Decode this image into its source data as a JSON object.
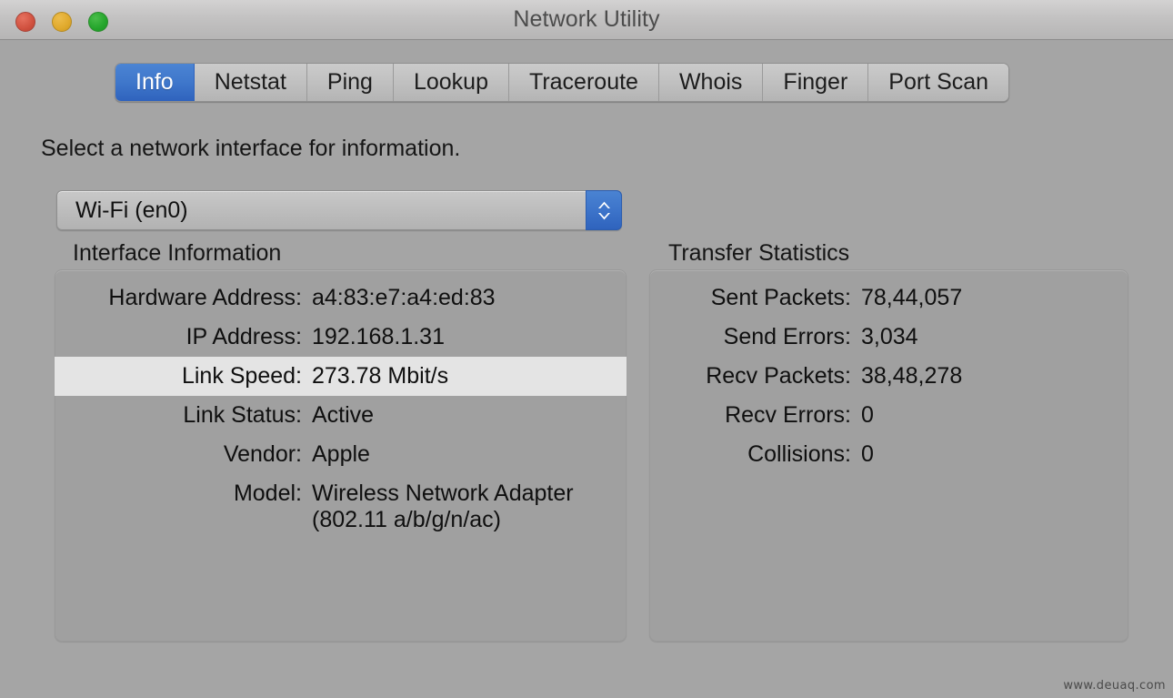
{
  "window": {
    "title": "Network Utility",
    "traffic_lights": [
      {
        "name": "close",
        "color": "#d0513f"
      },
      {
        "name": "minimize",
        "color": "#e0a92c"
      },
      {
        "name": "zoom",
        "color": "#24a52b"
      }
    ]
  },
  "tabs": [
    {
      "label": "Info",
      "selected": true
    },
    {
      "label": "Netstat",
      "selected": false
    },
    {
      "label": "Ping",
      "selected": false
    },
    {
      "label": "Lookup",
      "selected": false
    },
    {
      "label": "Traceroute",
      "selected": false
    },
    {
      "label": "Whois",
      "selected": false
    },
    {
      "label": "Finger",
      "selected": false
    },
    {
      "label": "Port Scan",
      "selected": false
    }
  ],
  "main": {
    "instruction": "Select a network interface for information.",
    "interface_select": {
      "value": "Wi-Fi (en0)",
      "stepper_icon": "chevron-up-down-icon",
      "accent": "#3d74ca"
    },
    "interface_information": {
      "title": "Interface Information",
      "rows": [
        {
          "label": "Hardware Address:",
          "value": "a4:83:e7:a4:ed:83",
          "highlighted": false
        },
        {
          "label": "IP Address:",
          "value": "192.168.1.31",
          "highlighted": false
        },
        {
          "label": "Link Speed:",
          "value": "273.78 Mbit/s",
          "highlighted": true
        },
        {
          "label": "Link Status:",
          "value": "Active",
          "highlighted": false
        },
        {
          "label": "Vendor:",
          "value": "Apple",
          "highlighted": false
        },
        {
          "label": "Model:",
          "value": "Wireless Network Adapter\n(802.11 a/b/g/n/ac)",
          "highlighted": false
        }
      ]
    },
    "transfer_statistics": {
      "title": "Transfer Statistics",
      "rows": [
        {
          "label": "Sent Packets:",
          "value": "78,44,057",
          "highlighted": false
        },
        {
          "label": "Send Errors:",
          "value": "3,034",
          "highlighted": false
        },
        {
          "label": "Recv Packets:",
          "value": "38,48,278",
          "highlighted": false
        },
        {
          "label": "Recv Errors:",
          "value": "0",
          "highlighted": false
        },
        {
          "label": "Collisions:",
          "value": "0",
          "highlighted": false
        }
      ]
    }
  },
  "watermark": "www.deuaq.com"
}
